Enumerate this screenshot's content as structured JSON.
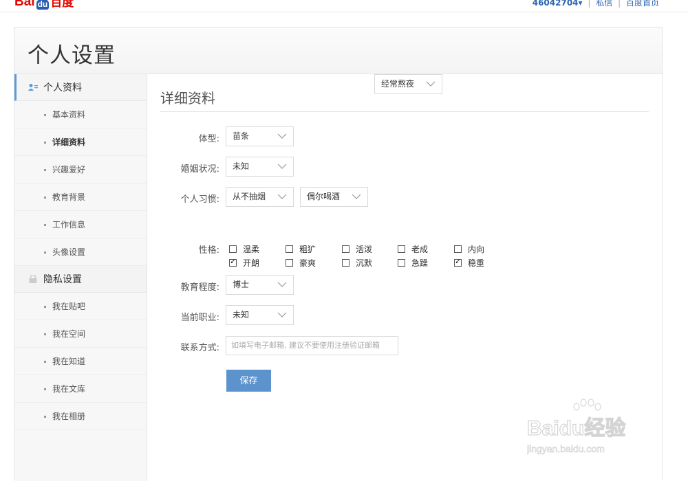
{
  "brand": {
    "logo_left": "Bai",
    "logo_mid": "du",
    "logo_right": "百度"
  },
  "topnav": {
    "username": "46042704▾",
    "messages": "私信",
    "homepage": "百度首页",
    "sep": "|"
  },
  "page": {
    "title": "个人设置",
    "section_title": "详细资料"
  },
  "sidebar": {
    "group_profile": "个人资料",
    "profile_items": [
      {
        "label": "基本资料"
      },
      {
        "label": "详细资料"
      },
      {
        "label": "兴趣爱好"
      },
      {
        "label": "教育背景"
      },
      {
        "label": "工作信息"
      },
      {
        "label": "头像设置"
      }
    ],
    "group_privacy": "隐私设置",
    "privacy_items": [
      {
        "label": "我在贴吧"
      },
      {
        "label": "我在空间"
      },
      {
        "label": "我在知道"
      },
      {
        "label": "我在文库"
      },
      {
        "label": "我在相册"
      }
    ]
  },
  "form": {
    "body_type": {
      "label": "体型:",
      "value": "苗条"
    },
    "marital": {
      "label": "婚姻状况:",
      "value": "未知"
    },
    "habits": {
      "label": "个人习惯:",
      "smoking": "从不抽烟",
      "drinking": "偶尔喝酒",
      "sleeping": "经常熬夜"
    },
    "personality": {
      "label": "性格:",
      "options": [
        {
          "label": "温柔",
          "checked": false
        },
        {
          "label": "粗犷",
          "checked": false
        },
        {
          "label": "活泼",
          "checked": false
        },
        {
          "label": "老成",
          "checked": false
        },
        {
          "label": "内向",
          "checked": false
        },
        {
          "label": "开朗",
          "checked": true
        },
        {
          "label": "豪爽",
          "checked": false
        },
        {
          "label": "沉默",
          "checked": false
        },
        {
          "label": "急躁",
          "checked": false
        },
        {
          "label": "稳重",
          "checked": true
        }
      ]
    },
    "education": {
      "label": "教育程度:",
      "value": "博士"
    },
    "occupation": {
      "label": "当前职业:",
      "value": "未知"
    },
    "contact": {
      "label": "联系方式:",
      "placeholder": "如填写电子邮箱, 建议不要使用注册验证邮箱"
    },
    "save_label": "保存"
  },
  "watermark": {
    "line1": "Baidu经验",
    "line2": "jingyan.baidu.com"
  },
  "colors": {
    "accent": "#5d93cd",
    "link": "#2d64b3",
    "brand_red": "#e10601"
  }
}
